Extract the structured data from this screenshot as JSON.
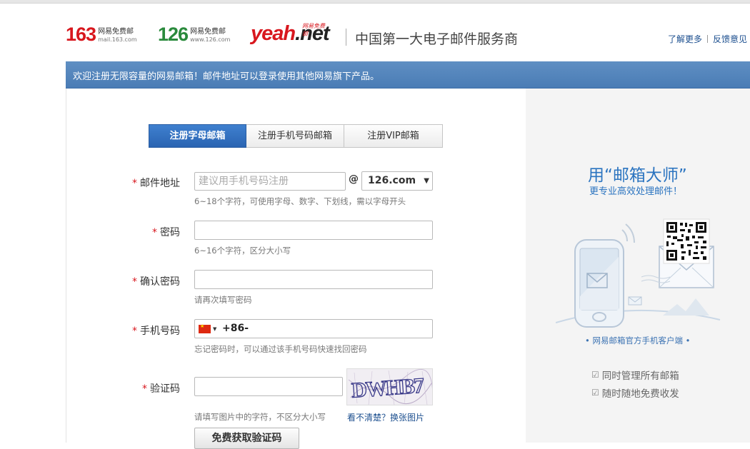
{
  "header": {
    "logo163": {
      "num": "163",
      "name": "网易免费邮",
      "url": "mail.163.com"
    },
    "logo126": {
      "num": "126",
      "name": "网易免费邮",
      "url": "www.126.com"
    },
    "logoyeah": {
      "text_yeah": "yeah",
      "text_net": ".net",
      "badge": "网易免费邮"
    },
    "slogan": "中国第一大电子邮件服务商",
    "links": {
      "learn_more": "了解更多",
      "feedback": "反馈意见"
    }
  },
  "banner": {
    "text": "欢迎注册无限容量的网易邮箱！邮件地址可以登录使用其他网易旗下产品。"
  },
  "tabs": [
    {
      "label": "注册字母邮箱",
      "active": true
    },
    {
      "label": "注册手机号码邮箱",
      "active": false
    },
    {
      "label": "注册VIP邮箱",
      "active": false
    }
  ],
  "form": {
    "required_mark": "*",
    "email": {
      "label": "邮件地址",
      "placeholder": "建议用手机号码注册",
      "at": "@",
      "domain": "126.com",
      "hint": "6~18个字符，可使用字母、数字、下划线，需以字母开头"
    },
    "password": {
      "label": "密码",
      "hint": "6~16个字符，区分大小写"
    },
    "confirm": {
      "label": "确认密码",
      "hint": "请再次填写密码"
    },
    "phone": {
      "label": "手机号码",
      "value": "+86-",
      "hint": "忘记密码时，可以通过该手机号码快速找回密码"
    },
    "captcha": {
      "label": "验证码",
      "image_text": "DWHB7",
      "hint": "请填写图片中的字符，不区分大小写",
      "refresh": "看不清楚？换张图片"
    },
    "get_code_button": "免费获取验证码"
  },
  "right_panel": {
    "title": "用“邮箱大师”",
    "subtitle": "更专业高效处理邮件！",
    "client_label": "• 网易邮箱官方手机客户端 •",
    "features": [
      "同时管理所有邮箱",
      "随时随地免费收发"
    ]
  },
  "colors": {
    "accent_blue": "#2a64b2",
    "banner_blue": "#4a7cb5",
    "required_red": "#d8171e",
    "link_blue": "#1c4f8f"
  }
}
